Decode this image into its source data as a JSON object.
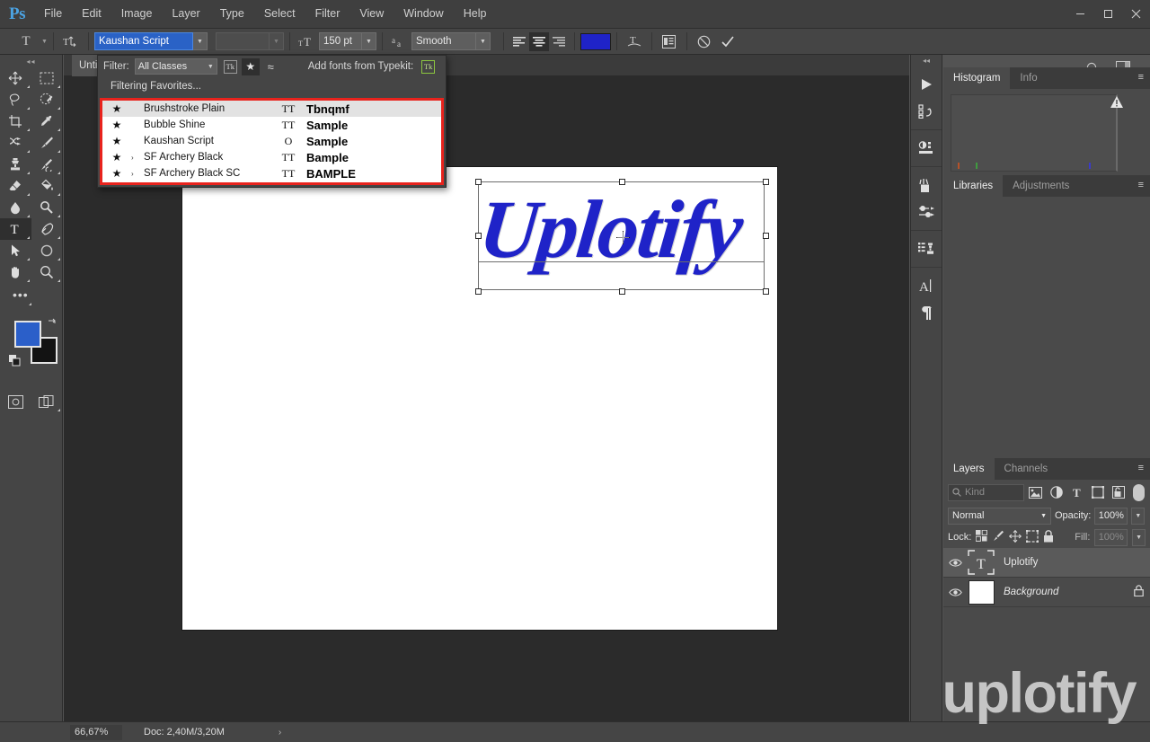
{
  "app": {
    "logo": "Ps"
  },
  "menubar": {
    "items": [
      "File",
      "Edit",
      "Image",
      "Layer",
      "Type",
      "Select",
      "Filter",
      "View",
      "Window",
      "Help"
    ]
  },
  "window_controls": {
    "minimize": "—",
    "maximize": "❐",
    "close": "✕"
  },
  "options_bar": {
    "tool_preset_icon": "T",
    "orientation_icon": "text-orientation",
    "font_family_value": "Kaushan Script",
    "font_style_value": "",
    "size_icon": "font-size",
    "font_size_value": "150 pt",
    "antialias_icon": "aa",
    "antialias_value": "Smooth",
    "align": {
      "left": "align-left",
      "center": "align-center",
      "right": "align-right",
      "active": "center"
    },
    "color_swatch": "#1f23c8",
    "warp_icon": "warp-text",
    "panels_icon": "toggle-character-panel",
    "cancel_icon": "cancel-edits",
    "commit_icon": "commit-edits",
    "search_icon": "search",
    "workspace_icon": "workspace-switcher"
  },
  "font_panel": {
    "filter_label": "Filter:",
    "filter_value": "All Classes",
    "typekit_button": "Tk",
    "favorites_button": "star",
    "similarity_button": "≈",
    "add_fonts_label": "Add fonts from Typekit:",
    "add_fonts_badge": "Tk",
    "status_text": "Filtering Favorites...",
    "highlight_color": "#e8231d",
    "rows": [
      {
        "star": "★",
        "expand": "",
        "name": "Brushstroke Plain",
        "type_icon": "TT",
        "sample": "Tbnqmf",
        "sample_style": "brushstroke",
        "highlighted": true
      },
      {
        "star": "★",
        "expand": "",
        "name": "Bubble Shine",
        "type_icon": "TT",
        "sample": "Sample",
        "sample_style": "bubble",
        "highlighted": false
      },
      {
        "star": "★",
        "expand": "",
        "name": "Kaushan Script",
        "type_icon": "O",
        "sample": "Sample",
        "sample_style": "script",
        "highlighted": false
      },
      {
        "star": "★",
        "expand": "›",
        "name": "SF Archery Black",
        "type_icon": "TT",
        "sample": "Bample",
        "sample_style": "archery",
        "highlighted": false
      },
      {
        "star": "★",
        "expand": "›",
        "name": "SF Archery Black SC",
        "type_icon": "TT",
        "sample": "BAMPLE",
        "sample_style": "archery-sc",
        "highlighted": false
      }
    ]
  },
  "toolbar": {
    "tools": [
      {
        "name": "move-tool",
        "icon": "move"
      },
      {
        "name": "rectangular-marquee",
        "icon": "marquee"
      },
      {
        "name": "lasso-tool",
        "icon": "lasso"
      },
      {
        "name": "quick-selection-tool",
        "icon": "quick-select"
      },
      {
        "name": "crop-tool",
        "icon": "crop"
      },
      {
        "name": "eyedropper-tool",
        "icon": "eyedropper"
      },
      {
        "name": "healing-brush-tool",
        "icon": "healing"
      },
      {
        "name": "brush-tool",
        "icon": "brush"
      },
      {
        "name": "clone-stamp-tool",
        "icon": "stamp"
      },
      {
        "name": "history-brush-tool",
        "icon": "history-brush"
      },
      {
        "name": "eraser-tool",
        "icon": "eraser"
      },
      {
        "name": "gradient-tool",
        "icon": "paint-bucket"
      },
      {
        "name": "blur-tool",
        "icon": "blur"
      },
      {
        "name": "dodge-tool",
        "icon": "dodge"
      },
      {
        "name": "type-tool",
        "icon": "T"
      },
      {
        "name": "pen-tool",
        "icon": "pen"
      },
      {
        "name": "path-selection-tool",
        "icon": "arrow"
      },
      {
        "name": "ellipse-tool",
        "icon": "ellipse"
      },
      {
        "name": "hand-tool",
        "icon": "hand"
      },
      {
        "name": "zoom-tool",
        "icon": "magnifier"
      }
    ],
    "active_tool": "type-tool",
    "more_tools": "•••",
    "foreground_color": "#2b5fc9",
    "background_color": "#131313",
    "swap_icon": "swap-colors",
    "default_icon": "default-colors",
    "quickmask_icon": "quick-mask",
    "screenmode_icon": "screen-mode"
  },
  "document": {
    "tab_label": "Until"
  },
  "canvas": {
    "artwork_text": "Uplotify",
    "artwork_color": "#1f23c8",
    "cursor_icon": "text-insert-cursor"
  },
  "rail": {
    "collapse_icon": "collapse-panels",
    "icons": [
      "actions-play-icon",
      "history-icon",
      "adjustments-icon",
      "swatches-icon",
      "brush-settings-icon",
      "styles-icon",
      "character-panel-icon",
      "paragraph-panel-icon"
    ]
  },
  "histogram_panel": {
    "tabs": [
      {
        "label": "Histogram",
        "active": true
      },
      {
        "label": "Info",
        "active": false
      }
    ],
    "menu_icon": "panel-menu",
    "warning_icon": "cached-data-warning"
  },
  "libraries_panel": {
    "tabs": [
      {
        "label": "Libraries",
        "active": true
      },
      {
        "label": "Adjustments",
        "active": false
      }
    ],
    "menu_icon": "panel-menu"
  },
  "layers_panel": {
    "tabs": [
      {
        "label": "Layers",
        "active": true
      },
      {
        "label": "Channels",
        "active": false
      }
    ],
    "menu_icon": "panel-menu",
    "filter_kind_label": "Kind",
    "filter_icons": [
      "pixel-filter-icon",
      "adjustment-filter-icon",
      "type-filter-icon",
      "shape-filter-icon",
      "smartobject-filter-icon"
    ],
    "blend_mode": "Normal",
    "opacity_label": "Opacity:",
    "opacity_value": "100%",
    "lock_label": "Lock:",
    "lock_icons": [
      "lock-transparent-icon",
      "lock-image-icon",
      "lock-position-icon",
      "lock-artboard-icon",
      "lock-all-icon"
    ],
    "fill_label": "Fill:",
    "fill_value": "100%",
    "layers": [
      {
        "name": "Uplotify",
        "thumb": "type-layer",
        "selected": true,
        "locked": false,
        "visible": true,
        "italic": false
      },
      {
        "name": "Background",
        "thumb": "white",
        "selected": false,
        "locked": true,
        "visible": true,
        "italic": true
      }
    ],
    "bottom_icons": [
      "link-layers-icon",
      "layer-style-icon",
      "layer-mask-icon",
      "adjustment-layer-icon",
      "new-group-icon",
      "new-layer-icon",
      "delete-layer-icon"
    ]
  },
  "status_bar": {
    "zoom": "66,67%",
    "doc_label": "Doc: 2,40M/3,20M",
    "expand_icon": "›"
  },
  "watermark": {
    "text": "uplotify"
  }
}
